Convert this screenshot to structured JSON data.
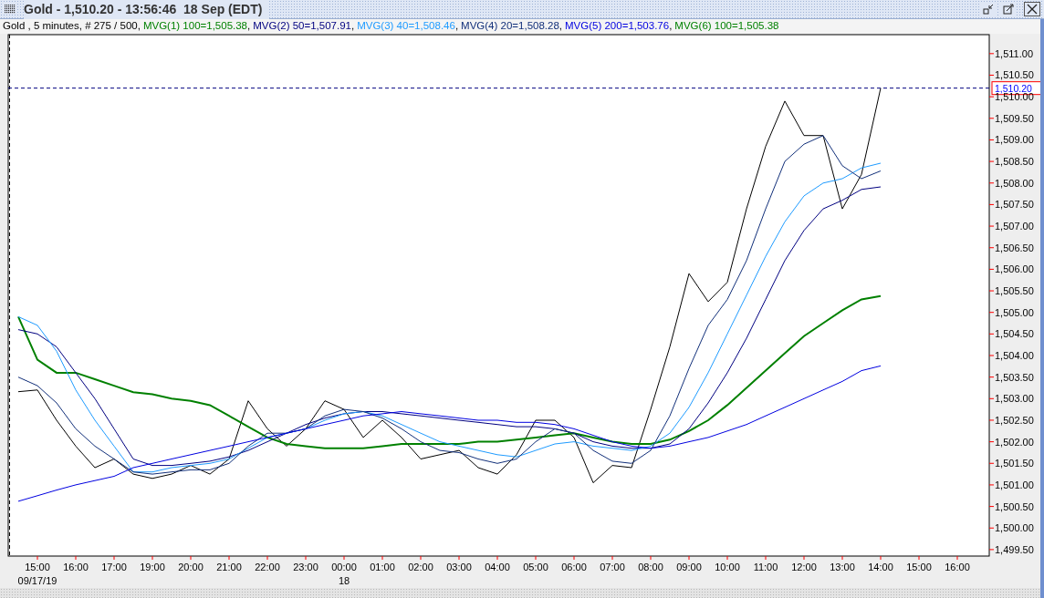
{
  "window": {
    "title": "Gold - 1,510.20 - 13:56:46  18 Sep (EDT)"
  },
  "legend": {
    "instrument": "Gold",
    "info": " , 5 minutes, # 275 / 500,",
    "items": [
      {
        "name": "MVG(1) 100",
        "value": "=1,505.38",
        "separator": ",",
        "color": "#008000"
      },
      {
        "name": "MVG(2) 50",
        "value": "=1,507.91",
        "separator": ",",
        "color": "#000080"
      },
      {
        "name": "MVG(3) 40",
        "value": "=1,508.46",
        "separator": ",",
        "color": "#1e9bff"
      },
      {
        "name": "MVG(4) 20",
        "value": "=1,508.28",
        "separator": ",",
        "color": "#12307a"
      },
      {
        "name": "MVG(5) 200",
        "value": "=1,503.76",
        "separator": ",",
        "color": "#0000e0"
      },
      {
        "name": "MVG(6) 100",
        "value": "=1,505.38",
        "color": "#008000"
      }
    ]
  },
  "chart_data": {
    "type": "line",
    "categories": [
      null,
      "15:00\n09/17/19",
      null,
      "16:00",
      null,
      "17:00",
      null,
      "19:00",
      null,
      "20:00",
      null,
      "21:00",
      null,
      "22:00",
      null,
      "23:00",
      null,
      "00:00\n18",
      null,
      "01:00",
      null,
      "02:00",
      null,
      "03:00",
      null,
      "04:00",
      null,
      "05:00",
      null,
      "06:00",
      null,
      "07:00",
      null,
      "08:00",
      null,
      "09:00",
      null,
      "10:00",
      null,
      "11:00",
      null,
      "12:00",
      null,
      "13:00",
      null,
      "14:00",
      null,
      "15:00",
      null,
      "16:00",
      null
    ],
    "series": [
      {
        "color": "#000000",
        "values": [
          1503.16,
          1503.2,
          1502.5,
          1501.9,
          1501.4,
          1501.6,
          1501.25,
          1501.15,
          1501.25,
          1501.45,
          1501.25,
          1501.6,
          1502.95,
          1502.3,
          1501.9,
          1502.3,
          1502.95,
          1502.75,
          1502.1,
          1502.5,
          1502.1,
          1501.6,
          1501.7,
          1501.8,
          1501.4,
          1501.25,
          1501.7,
          1502.5,
          1502.5,
          1502.1,
          1501.05,
          1501.45,
          1501.4,
          1502.75,
          1504.2,
          1505.9,
          1505.25,
          1505.7,
          1507.4,
          1508.85,
          1509.9,
          1509.1,
          1509.1,
          1507.4,
          1508.2,
          1510.2,
          null,
          null,
          null,
          null,
          null
        ]
      },
      {
        "color": "#008000",
        "values": [
          1504.9,
          1503.9,
          1503.6,
          1503.6,
          1503.45,
          1503.3,
          1503.15,
          1503.1,
          1503.0,
          1502.95,
          1502.85,
          1502.6,
          1502.35,
          1502.1,
          1501.95,
          1501.9,
          1501.85,
          1501.85,
          1501.85,
          1501.9,
          1501.95,
          1501.95,
          1501.95,
          1501.95,
          1502.0,
          1502.0,
          1502.05,
          1502.1,
          1502.15,
          1502.2,
          1502.1,
          1502.0,
          1501.95,
          1501.95,
          1502.05,
          1502.25,
          1502.5,
          1502.85,
          1503.25,
          1503.65,
          1504.05,
          1504.45,
          1504.75,
          1505.05,
          1505.3,
          1505.38,
          null,
          null,
          null,
          null,
          null
        ]
      },
      {
        "color": "#000080",
        "values": [
          1504.6,
          1504.5,
          1504.2,
          1503.6,
          1503.0,
          1502.3,
          1501.6,
          1501.45,
          1501.45,
          1501.5,
          1501.55,
          1501.65,
          1501.8,
          1502.0,
          1502.2,
          1502.4,
          1502.55,
          1502.65,
          1502.7,
          1502.7,
          1502.65,
          1502.6,
          1502.55,
          1502.5,
          1502.45,
          1502.4,
          1502.35,
          1502.35,
          1502.3,
          1502.2,
          1502.0,
          1501.9,
          1501.85,
          1501.85,
          1501.95,
          1502.3,
          1502.9,
          1503.6,
          1504.4,
          1505.3,
          1506.2,
          1506.9,
          1507.4,
          1507.6,
          1507.85,
          1507.91,
          null,
          null,
          null,
          null,
          null
        ]
      },
      {
        "color": "#1e9bff",
        "values": [
          1504.9,
          1504.7,
          1504.1,
          1503.2,
          1502.5,
          1501.9,
          1501.3,
          1501.3,
          1501.4,
          1501.45,
          1501.5,
          1501.6,
          1501.85,
          1502.1,
          1502.2,
          1502.3,
          1502.5,
          1502.65,
          1502.7,
          1502.6,
          1502.4,
          1502.2,
          1502.0,
          1501.9,
          1501.8,
          1501.7,
          1501.65,
          1501.8,
          1501.95,
          1502.0,
          1501.9,
          1501.85,
          1501.8,
          1501.9,
          1502.2,
          1502.8,
          1503.6,
          1504.5,
          1505.4,
          1506.3,
          1507.1,
          1507.7,
          1508.0,
          1508.1,
          1508.35,
          1508.46,
          null,
          null,
          null,
          null,
          null
        ]
      },
      {
        "color": "#12307a",
        "values": [
          1503.5,
          1503.3,
          1502.9,
          1502.3,
          1501.9,
          1501.6,
          1501.3,
          1501.25,
          1501.3,
          1501.35,
          1501.35,
          1501.5,
          1501.9,
          1502.2,
          1502.2,
          1502.3,
          1502.6,
          1502.75,
          1502.7,
          1502.55,
          1502.3,
          1502.0,
          1501.8,
          1501.75,
          1501.6,
          1501.5,
          1501.6,
          1502.0,
          1502.3,
          1502.2,
          1501.8,
          1501.55,
          1501.5,
          1501.8,
          1502.6,
          1503.7,
          1504.7,
          1505.3,
          1506.2,
          1507.4,
          1508.5,
          1508.9,
          1509.1,
          1508.4,
          1508.1,
          1508.28,
          null,
          null,
          null,
          null,
          null
        ]
      },
      {
        "color": "#0000e0",
        "values": [
          1500.62,
          1500.75,
          1500.88,
          1501.0,
          1501.1,
          1501.2,
          1501.4,
          1501.5,
          1501.6,
          1501.7,
          1501.8,
          1501.9,
          1502.0,
          1502.1,
          1502.2,
          1502.3,
          1502.4,
          1502.5,
          1502.6,
          1502.65,
          1502.7,
          1502.65,
          1502.6,
          1502.55,
          1502.5,
          1502.5,
          1502.45,
          1502.45,
          1502.4,
          1502.3,
          1502.15,
          1502.0,
          1501.9,
          1501.85,
          1501.9,
          1502.0,
          1502.1,
          1502.25,
          1502.4,
          1502.6,
          1502.8,
          1503.0,
          1503.2,
          1503.4,
          1503.65,
          1503.76,
          null,
          null,
          null,
          null,
          null
        ]
      }
    ],
    "ylim": [
      1499.35,
      1511.44
    ],
    "yticks": [
      {
        "value": 1499.5,
        "label": "1,499.50"
      },
      {
        "value": 1500,
        "label": "1,500.00"
      },
      {
        "value": 1500.5,
        "label": "1,500.50"
      },
      {
        "value": 1501,
        "label": "1,501.00"
      },
      {
        "value": 1501.5,
        "label": "1,501.50"
      },
      {
        "value": 1502,
        "label": "1,502.00"
      },
      {
        "value": 1502.5,
        "label": "1,502.50"
      },
      {
        "value": 1503,
        "label": "1,503.00"
      },
      {
        "value": 1503.5,
        "label": "1,503.50"
      },
      {
        "value": 1504,
        "label": "1,504.00"
      },
      {
        "value": 1504.5,
        "label": "1,504.50"
      },
      {
        "value": 1505,
        "label": "1,505.00"
      },
      {
        "value": 1505.5,
        "label": "1,505.50"
      },
      {
        "value": 1506,
        "label": "1,506.00"
      },
      {
        "value": 1506.5,
        "label": "1,506.50"
      },
      {
        "value": 1507,
        "label": "1,507.00"
      },
      {
        "value": 1507.5,
        "label": "1,507.50"
      },
      {
        "value": 1508,
        "label": "1,508.00"
      },
      {
        "value": 1508.5,
        "label": "1,508.50"
      },
      {
        "value": 1509,
        "label": "1,509.00"
      },
      {
        "value": 1509.5,
        "label": "1,509.50"
      },
      {
        "value": 1510,
        "label": "1,510.00"
      },
      {
        "value": 1510.5,
        "label": "1,510.50"
      },
      {
        "value": 1511,
        "label": "1,511.00"
      }
    ],
    "ref_lines": [
      {
        "axis": "y",
        "value": 1510.2,
        "label": "1,510.20"
      }
    ]
  }
}
